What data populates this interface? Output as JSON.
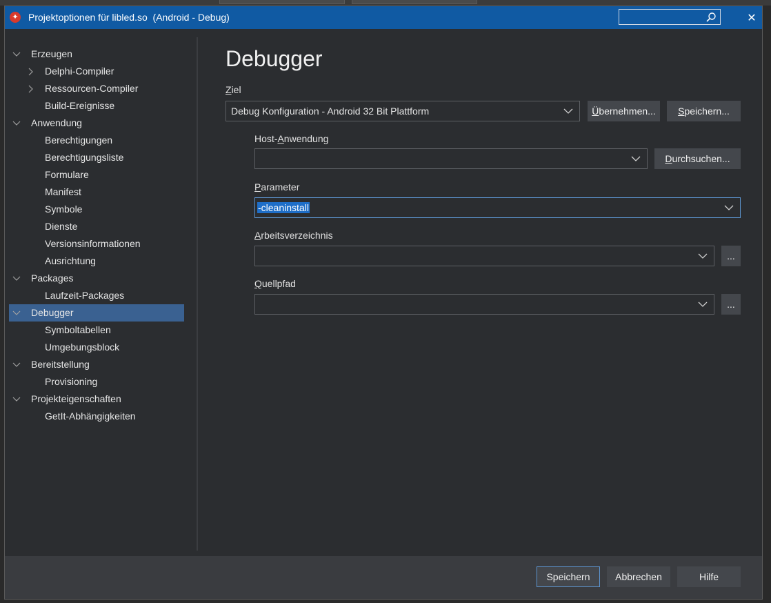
{
  "window": {
    "title": "Projektoptionen für libled.so  (Android - Debug)",
    "search_placeholder": ""
  },
  "tree": [
    {
      "label": "Erzeugen",
      "level": 0,
      "expanded": true
    },
    {
      "label": "Delphi-Compiler",
      "level": 1,
      "collapsed": true
    },
    {
      "label": "Ressourcen-Compiler",
      "level": 1,
      "collapsed": true
    },
    {
      "label": "Build-Ereignisse",
      "level": 1
    },
    {
      "label": "Anwendung",
      "level": 0,
      "expanded": true
    },
    {
      "label": "Berechtigungen",
      "level": 1
    },
    {
      "label": "Berechtigungsliste",
      "level": 1
    },
    {
      "label": "Formulare",
      "level": 1
    },
    {
      "label": "Manifest",
      "level": 1
    },
    {
      "label": "Symbole",
      "level": 1
    },
    {
      "label": "Dienste",
      "level": 1
    },
    {
      "label": "Versionsinformationen",
      "level": 1
    },
    {
      "label": "Ausrichtung",
      "level": 1
    },
    {
      "label": "Packages",
      "level": 0,
      "expanded": true
    },
    {
      "label": "Laufzeit-Packages",
      "level": 1
    },
    {
      "label": "Debugger",
      "level": 0,
      "expanded": true,
      "selected": true
    },
    {
      "label": "Symboltabellen",
      "level": 1
    },
    {
      "label": "Umgebungsblock",
      "level": 1
    },
    {
      "label": "Bereitstellung",
      "level": 0,
      "expanded": true
    },
    {
      "label": "Provisioning",
      "level": 1
    },
    {
      "label": "Projekteigenschaften",
      "level": 0,
      "expanded": true
    },
    {
      "label": "GetIt-Abhängigkeiten",
      "level": 1
    }
  ],
  "page": {
    "title": "Debugger",
    "ziel": {
      "label_u": "Z",
      "label_rest": "iel",
      "value": "Debug Konfiguration - Android 32 Bit Plattform",
      "apply_u": "Ü",
      "apply_rest": "bernehmen...",
      "save_u": "S",
      "save_rest": "peichern..."
    },
    "host": {
      "label_pre": "Host-",
      "label_u": "A",
      "label_rest": "nwendung",
      "value": "",
      "browse_u": "D",
      "browse_rest": "urchsuchen..."
    },
    "parameter": {
      "label_u": "P",
      "label_rest": "arameter",
      "value": "-cleaninstall"
    },
    "workdir": {
      "label_u": "A",
      "label_rest": "rbeitsverzeichnis",
      "value": "",
      "browse": "..."
    },
    "source": {
      "label_u": "Q",
      "label_rest": "uellpfad",
      "value": "",
      "browse": "..."
    }
  },
  "footer": {
    "save": "Speichern",
    "cancel": "Abbrechen",
    "help": "Hilfe"
  }
}
